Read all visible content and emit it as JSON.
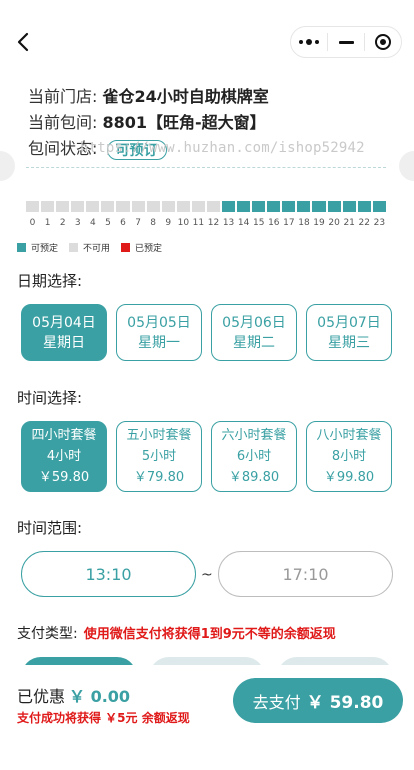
{
  "topbar": {
    "back_icon": "chevron-left-icon",
    "capsule_icons": [
      "more-dots-icon",
      "minimize-icon",
      "target-icon"
    ]
  },
  "store": {
    "store_label": "当前门店:",
    "store_name": "雀仓24小时自助棋牌室",
    "room_label": "当前包间:",
    "room_name": "8801【旺角-超大窗】",
    "status_label": "包间状态:",
    "status_value": "可预订"
  },
  "watermark": "https://www.huzhan.com/ishop52942",
  "timeline": {
    "hours": [
      "0",
      "1",
      "2",
      "3",
      "4",
      "5",
      "6",
      "7",
      "8",
      "9",
      "10",
      "11",
      "12",
      "13",
      "14",
      "15",
      "16",
      "17",
      "18",
      "19",
      "20",
      "21",
      "22",
      "23"
    ],
    "states": [
      "unavailable",
      "unavailable",
      "unavailable",
      "unavailable",
      "unavailable",
      "unavailable",
      "unavailable",
      "unavailable",
      "unavailable",
      "unavailable",
      "unavailable",
      "unavailable",
      "unavailable",
      "available",
      "available",
      "available",
      "available",
      "available",
      "available",
      "available",
      "available",
      "available",
      "available",
      "available"
    ],
    "legend": [
      {
        "label": "可预定",
        "color": "#3aa0a3"
      },
      {
        "label": "不可用",
        "color": "#dcdcdc"
      },
      {
        "label": "已预定",
        "color": "#e01919"
      }
    ]
  },
  "date_section": {
    "title": "日期选择:",
    "dates": [
      {
        "date": "05月04日",
        "weekday": "星期日",
        "selected": true
      },
      {
        "date": "05月05日",
        "weekday": "星期一",
        "selected": false
      },
      {
        "date": "05月06日",
        "weekday": "星期二",
        "selected": false
      },
      {
        "date": "05月07日",
        "weekday": "星期三",
        "selected": false
      }
    ]
  },
  "package_section": {
    "title": "时间选择:",
    "packages": [
      {
        "name": "四小时套餐",
        "hours": "4小时",
        "price": "￥59.80",
        "selected": true
      },
      {
        "name": "五小时套餐",
        "hours": "5小时",
        "price": "￥79.80",
        "selected": false
      },
      {
        "name": "六小时套餐",
        "hours": "6小时",
        "price": "￥89.80",
        "selected": false
      },
      {
        "name": "八小时套餐",
        "hours": "8小时",
        "price": "￥99.80",
        "selected": false
      }
    ]
  },
  "range_section": {
    "title": "时间范围:",
    "start": "13:10",
    "separator": "~",
    "end": "17:10"
  },
  "pay_section": {
    "title": "支付类型:",
    "hint": "使用微信支付将获得1到9元不等的余额返现"
  },
  "bottom": {
    "discount_label": "已优惠",
    "discount_amount": "￥ 0.00",
    "cashback": "支付成功将获得 ￥5元 余额返现",
    "pay_label": "去支付",
    "pay_price": "￥ 59.80"
  },
  "colors": {
    "accent": "#3aa0a3",
    "booked": "#e01919",
    "unavailable": "#dcdcdc"
  }
}
